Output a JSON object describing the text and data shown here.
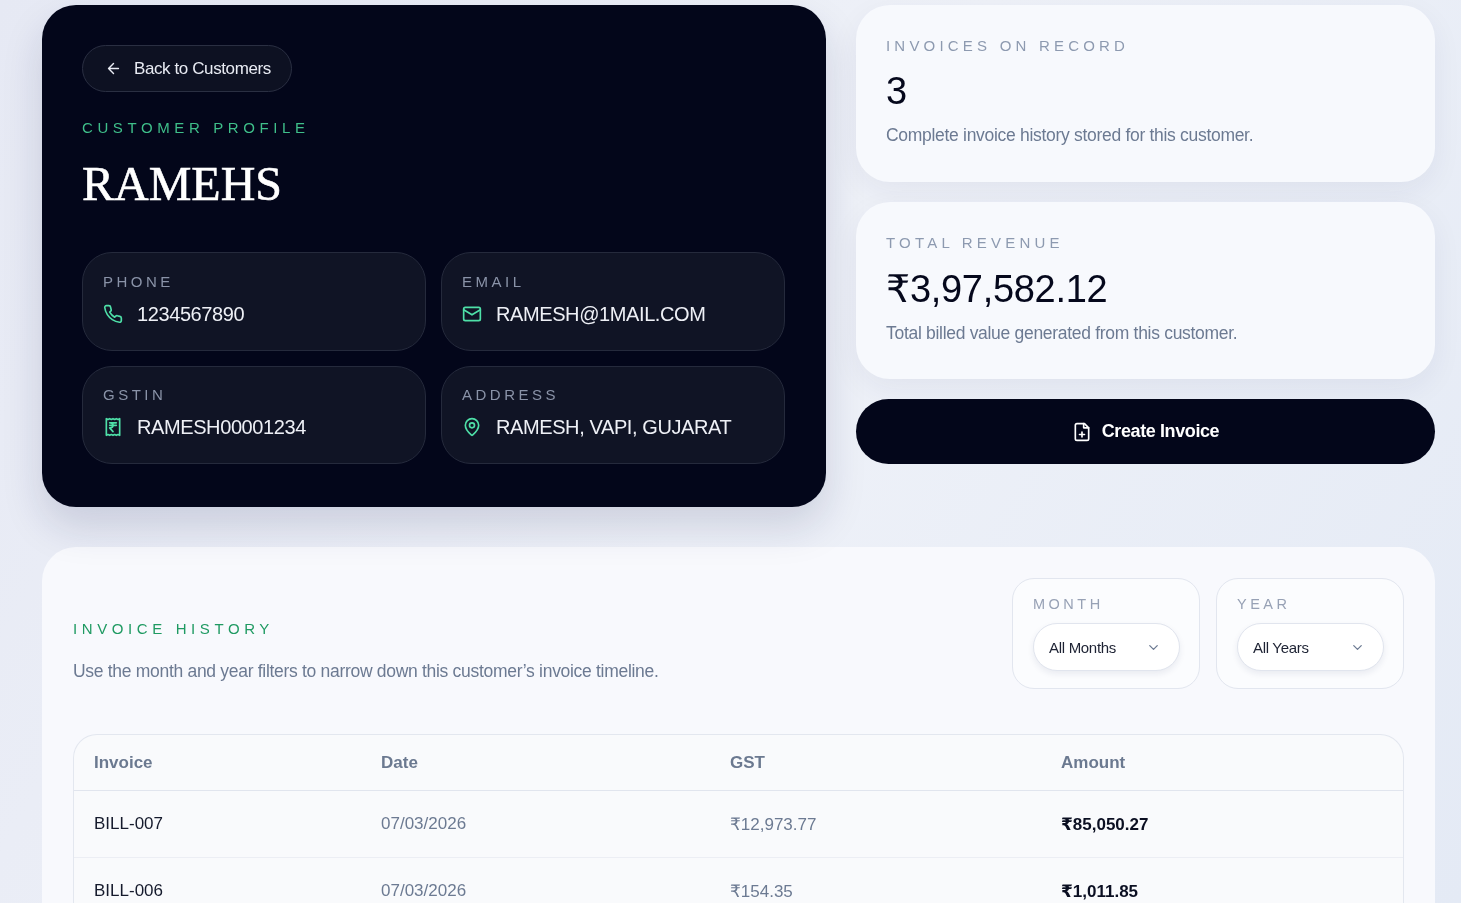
{
  "profile": {
    "back_button": "Back to Customers",
    "eyebrow": "CUSTOMER PROFILE",
    "name": "RAMEHS",
    "fields": [
      {
        "kind": "phone",
        "label": "PHONE",
        "value": "1234567890"
      },
      {
        "kind": "email",
        "label": "EMAIL",
        "value": "RAMESH@1MAIL.COM"
      },
      {
        "kind": "gstin",
        "label": "GSTIN",
        "value": "RAMESH00001234"
      },
      {
        "kind": "address",
        "label": "ADDRESS",
        "value": "RAMESH, VAPI, GUJARAT"
      }
    ]
  },
  "stats": [
    {
      "label": "INVOICES ON RECORD",
      "value": "3",
      "note": "Complete invoice history stored for this customer."
    },
    {
      "label": "TOTAL REVENUE",
      "value": "₹3,97,582.12",
      "note": "Total billed value generated from this customer."
    }
  ],
  "create_button": "Create Invoice",
  "history": {
    "eyebrow": "INVOICE HISTORY",
    "description": "Use the month and year filters to narrow down this customer’s invoice timeline.",
    "filters": [
      {
        "label": "MONTH",
        "value": "All Months"
      },
      {
        "label": "YEAR",
        "value": "All Years"
      }
    ],
    "table": {
      "columns": [
        "Invoice",
        "Date",
        "GST",
        "Amount"
      ],
      "rows": [
        [
          "BILL-007",
          "07/03/2026",
          "₹12,973.77",
          "₹85,050.27"
        ],
        [
          "BILL-006",
          "07/03/2026",
          "₹154.35",
          "₹1,011.85"
        ]
      ]
    }
  }
}
